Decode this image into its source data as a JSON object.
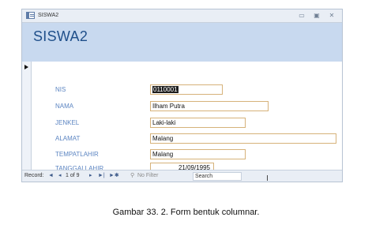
{
  "window": {
    "title": "SISWA2",
    "controls": {
      "minimize": "▭",
      "restore": "▣",
      "close": "✕"
    }
  },
  "form": {
    "heading": "SISWA2",
    "fields": [
      {
        "label": "NIS",
        "value": "0110001"
      },
      {
        "label": "NAMA",
        "value": "Ilham Putra"
      },
      {
        "label": "JENKEL",
        "value": "Laki-laki"
      },
      {
        "label": "ALAMAT",
        "value": "Malang"
      },
      {
        "label": "TEMPATLAHIR",
        "value": "Malang"
      },
      {
        "label": "TANGGALLAHIR",
        "value": "21/09/1995"
      }
    ]
  },
  "navigation": {
    "record_label": "Record:",
    "first": "◄",
    "prev": "◂",
    "position": "1 of 9",
    "next": "▸",
    "last": "►|",
    "new": "►✱",
    "filter_icon": "⚲",
    "no_filter": "No Filter",
    "search_placeholder": "Search"
  },
  "cursor_icon": "I-beam",
  "caption": "Gambar 33. 2. Form bentuk columnar.",
  "colors": {
    "header_bg": "#c8d9ef",
    "heading_text": "#1f4f8a",
    "label_text": "#5c85c2",
    "field_border": "#d6b27a"
  }
}
